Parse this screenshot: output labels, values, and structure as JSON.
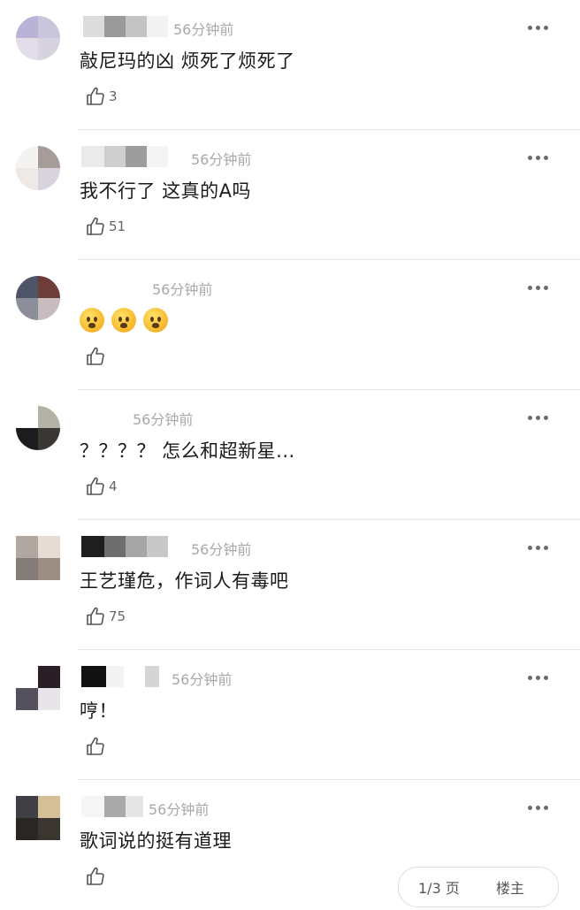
{
  "comments": [
    {
      "username": "",
      "time": "56分钟前",
      "text": "敲尼玛的凶 烦死了烦死了",
      "likes": "3"
    },
    {
      "username": "",
      "time": "56分钟前",
      "text": "我不行了 这真的A吗",
      "likes": "51"
    },
    {
      "username": "",
      "time": "56分钟前",
      "text": "",
      "emojis": [
        "anguished-face-emoji",
        "anguished-face-emoji",
        "anguished-face-emoji"
      ],
      "likes": ""
    },
    {
      "username": "",
      "time": "56分钟前",
      "text": "？？？？ 怎么和超新星...",
      "likes": "4"
    },
    {
      "username": "",
      "time": "56分钟前",
      "text": "王艺瑾危，作词人有毒吧",
      "likes": "75"
    },
    {
      "username": "",
      "time": "56分钟前",
      "text": "哼！",
      "likes": ""
    },
    {
      "username": "",
      "time": "56分钟前",
      "text": "歌词说的挺有道理",
      "likes": ""
    }
  ],
  "icons": {
    "more": "more-options-icon",
    "like": "thumbs-up-icon"
  },
  "colors": {
    "time": "#a8a8a8",
    "divider": "#e6e6e6",
    "like_count": "#666666"
  },
  "pager": {
    "left_label": "1/3 页",
    "right_label": "楼主"
  }
}
